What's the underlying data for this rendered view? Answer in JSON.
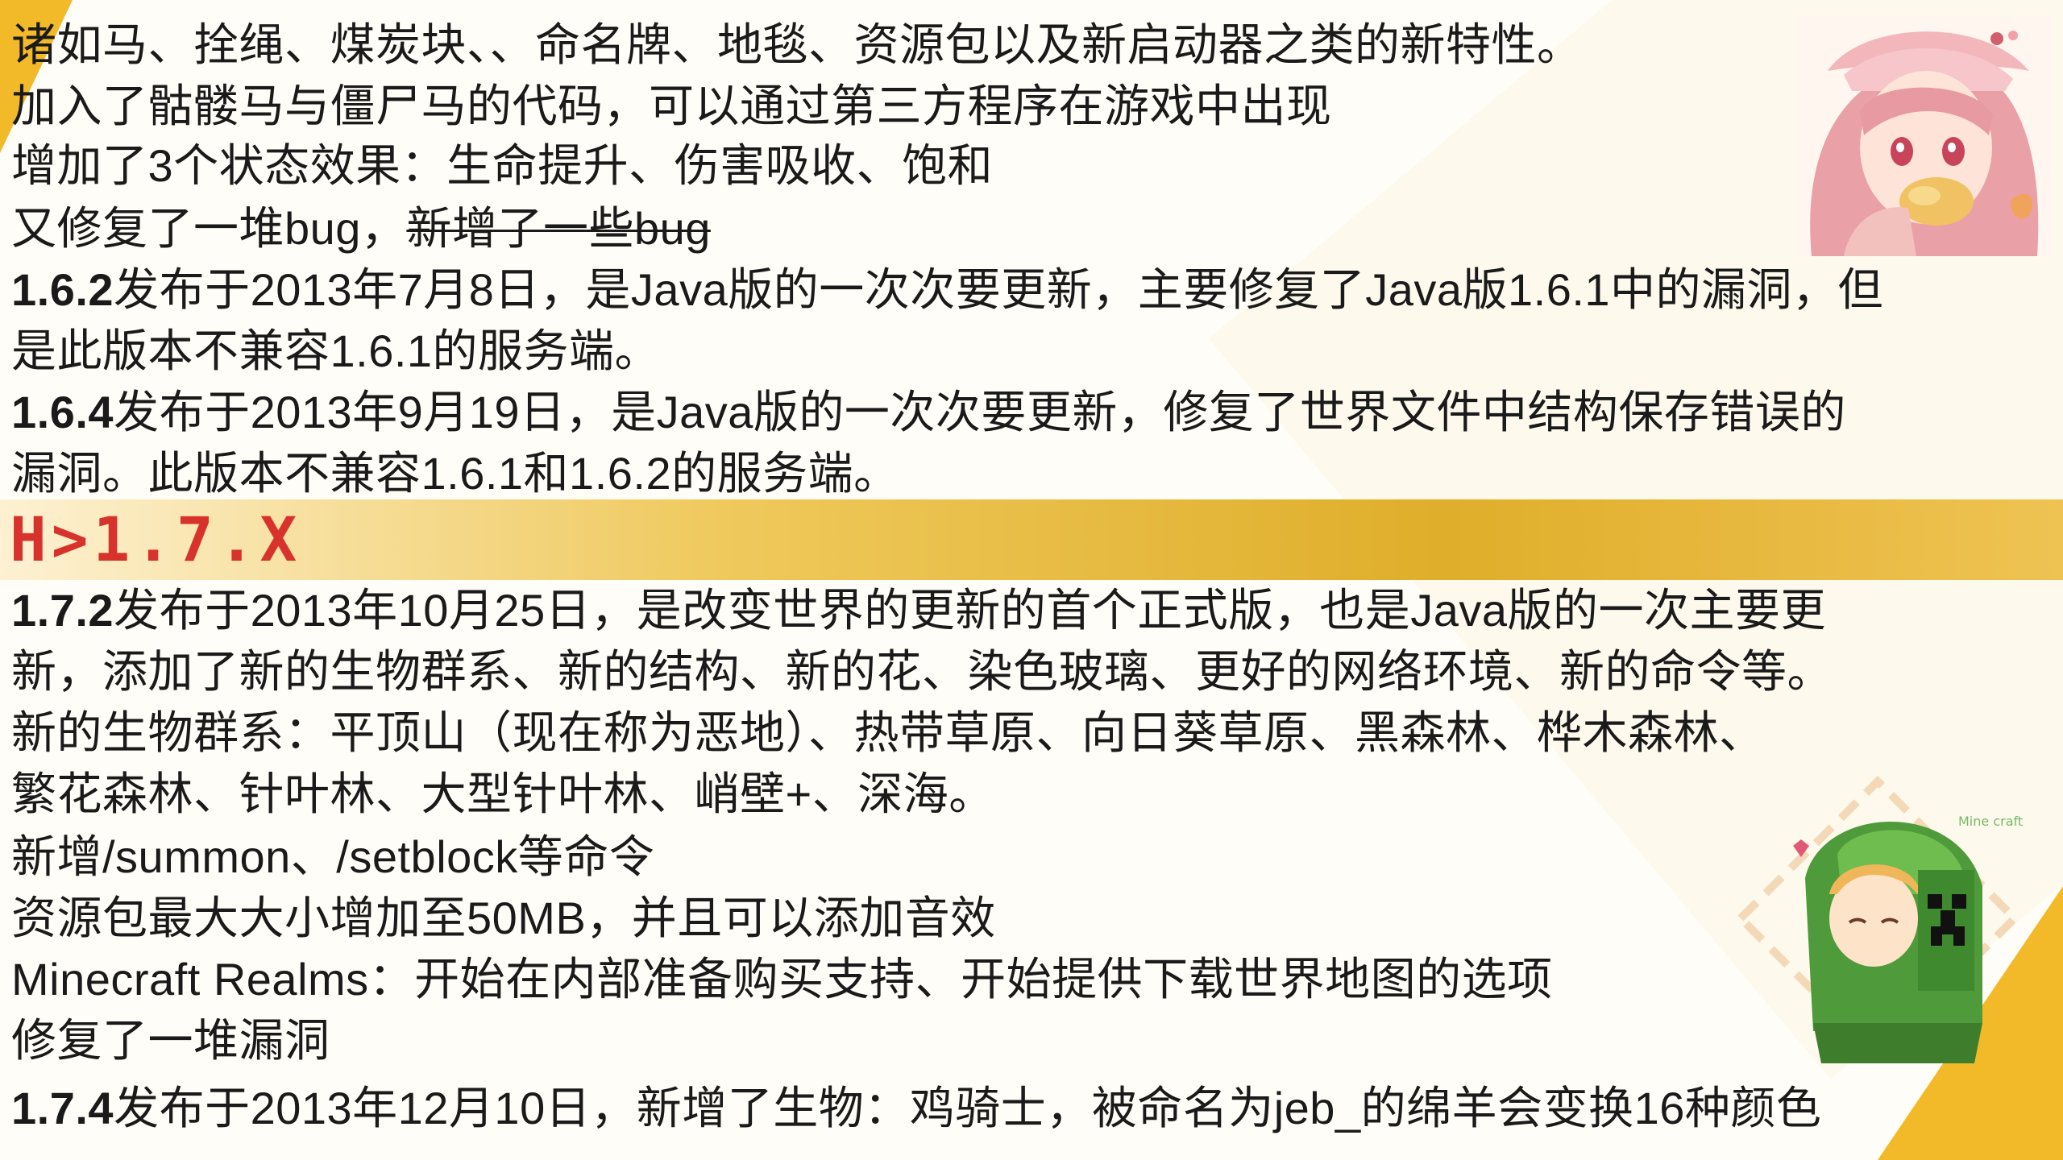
{
  "lines_top": [
    {
      "id": "l1",
      "parts": [
        {
          "t": "诸如马、拴绳、煤炭块、、命名牌、地毯、资源包以及新启动器之类的新特性。"
        }
      ]
    },
    {
      "id": "l2",
      "parts": [
        {
          "t": "加入了骷髅马与僵尸马的代码，可以通过第三方程序在游戏中出现"
        }
      ]
    },
    {
      "id": "l3",
      "parts": [
        {
          "t": "增加了3个状态效果：生命提升、伤害吸收、饱和"
        }
      ]
    },
    {
      "id": "l4",
      "parts": [
        {
          "t": "又修复了一堆bug，"
        },
        {
          "t": "新增了一些bug",
          "strike": true
        }
      ]
    },
    {
      "id": "l5",
      "parts": [
        {
          "t": "1.6.2",
          "bold": true
        },
        {
          "t": "发布于2013年7月8日，是Java版的一次次要更新，主要修复了Java版1.6.1中的漏洞，但"
        }
      ]
    },
    {
      "id": "l6",
      "parts": [
        {
          "t": "是此版本不兼容1.6.1的服务端。"
        }
      ]
    },
    {
      "id": "l7",
      "parts": [
        {
          "t": "1.6.4",
          "bold": true
        },
        {
          "t": "发布于2013年9月19日，是Java版的一次次要更新，修复了世界文件中结构保存错误的"
        }
      ]
    },
    {
      "id": "l8",
      "parts": [
        {
          "t": "漏洞。此版本不兼容1.6.1和1.6.2的服务端。"
        }
      ]
    }
  ],
  "section_heading": "H>1.7.X",
  "lines_bottom": [
    {
      "id": "b1",
      "parts": [
        {
          "t": "1.7.2",
          "bold": true
        },
        {
          "t": "发布于2013年10月25日，是改变世界的更新的首个正式版，也是Java版的一次主要更"
        }
      ]
    },
    {
      "id": "b2",
      "parts": [
        {
          "t": "新，添加了新的生物群系、新的结构、新的花、染色玻璃、更好的网络环境、新的命令等。"
        }
      ]
    },
    {
      "id": "b3",
      "parts": [
        {
          "t": "新的生物群系：平顶山（现在称为恶地）、热带草原、向日葵草原、黑森林、桦木森林、"
        }
      ]
    },
    {
      "id": "b4",
      "parts": [
        {
          "t": "繁花森林、针叶林、大型针叶林、峭壁+、深海。"
        }
      ]
    },
    {
      "id": "b5",
      "parts": [
        {
          "t": "新增/summon、/setblock等命令"
        }
      ]
    },
    {
      "id": "b6",
      "parts": [
        {
          "t": "资源包最大大小增加至50MB，并且可以添加音效"
        }
      ]
    },
    {
      "id": "b7",
      "parts": [
        {
          "t": "Minecraft Realms：开始在内部准备购买支持、开始提供下载世界地图的选项"
        }
      ]
    },
    {
      "id": "b8",
      "parts": [
        {
          "t": "修复了一堆漏洞"
        }
      ]
    },
    {
      "id": "b9",
      "parts": [
        {
          "t": "1.7.4",
          "bold": true
        },
        {
          "t": "发布于2013年12月10日，新增了生物：鸡骑士，被命名为jeb_的绵羊会变换16种颜色"
        }
      ]
    }
  ],
  "art_bottom_text": "Mine craft",
  "colors": {
    "accent": "#f2b928",
    "heading": "#d8322c"
  }
}
